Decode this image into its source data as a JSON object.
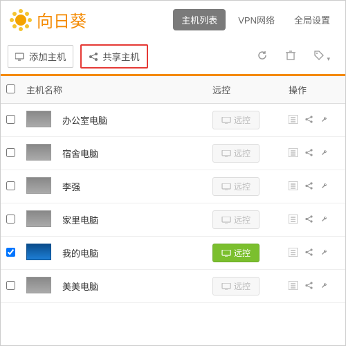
{
  "header": {
    "app_name": "向日葵",
    "tabs": {
      "hosts": "主机列表",
      "vpn": "VPN网络",
      "settings": "全局设置"
    }
  },
  "toolbar": {
    "add_host": "添加主机",
    "share_host": "共享主机"
  },
  "table": {
    "col_name": "主机名称",
    "col_remote": "远控",
    "col_ops": "操作",
    "remote_label": "远控"
  },
  "hosts": [
    {
      "name": "办公室电脑",
      "online": false,
      "checked": false
    },
    {
      "name": "宿舍电脑",
      "online": false,
      "checked": false
    },
    {
      "name": "李强",
      "online": false,
      "checked": false
    },
    {
      "name": "家里电脑",
      "online": false,
      "checked": false
    },
    {
      "name": "我的电脑",
      "online": true,
      "checked": true
    },
    {
      "name": "美美电脑",
      "online": false,
      "checked": false
    }
  ]
}
